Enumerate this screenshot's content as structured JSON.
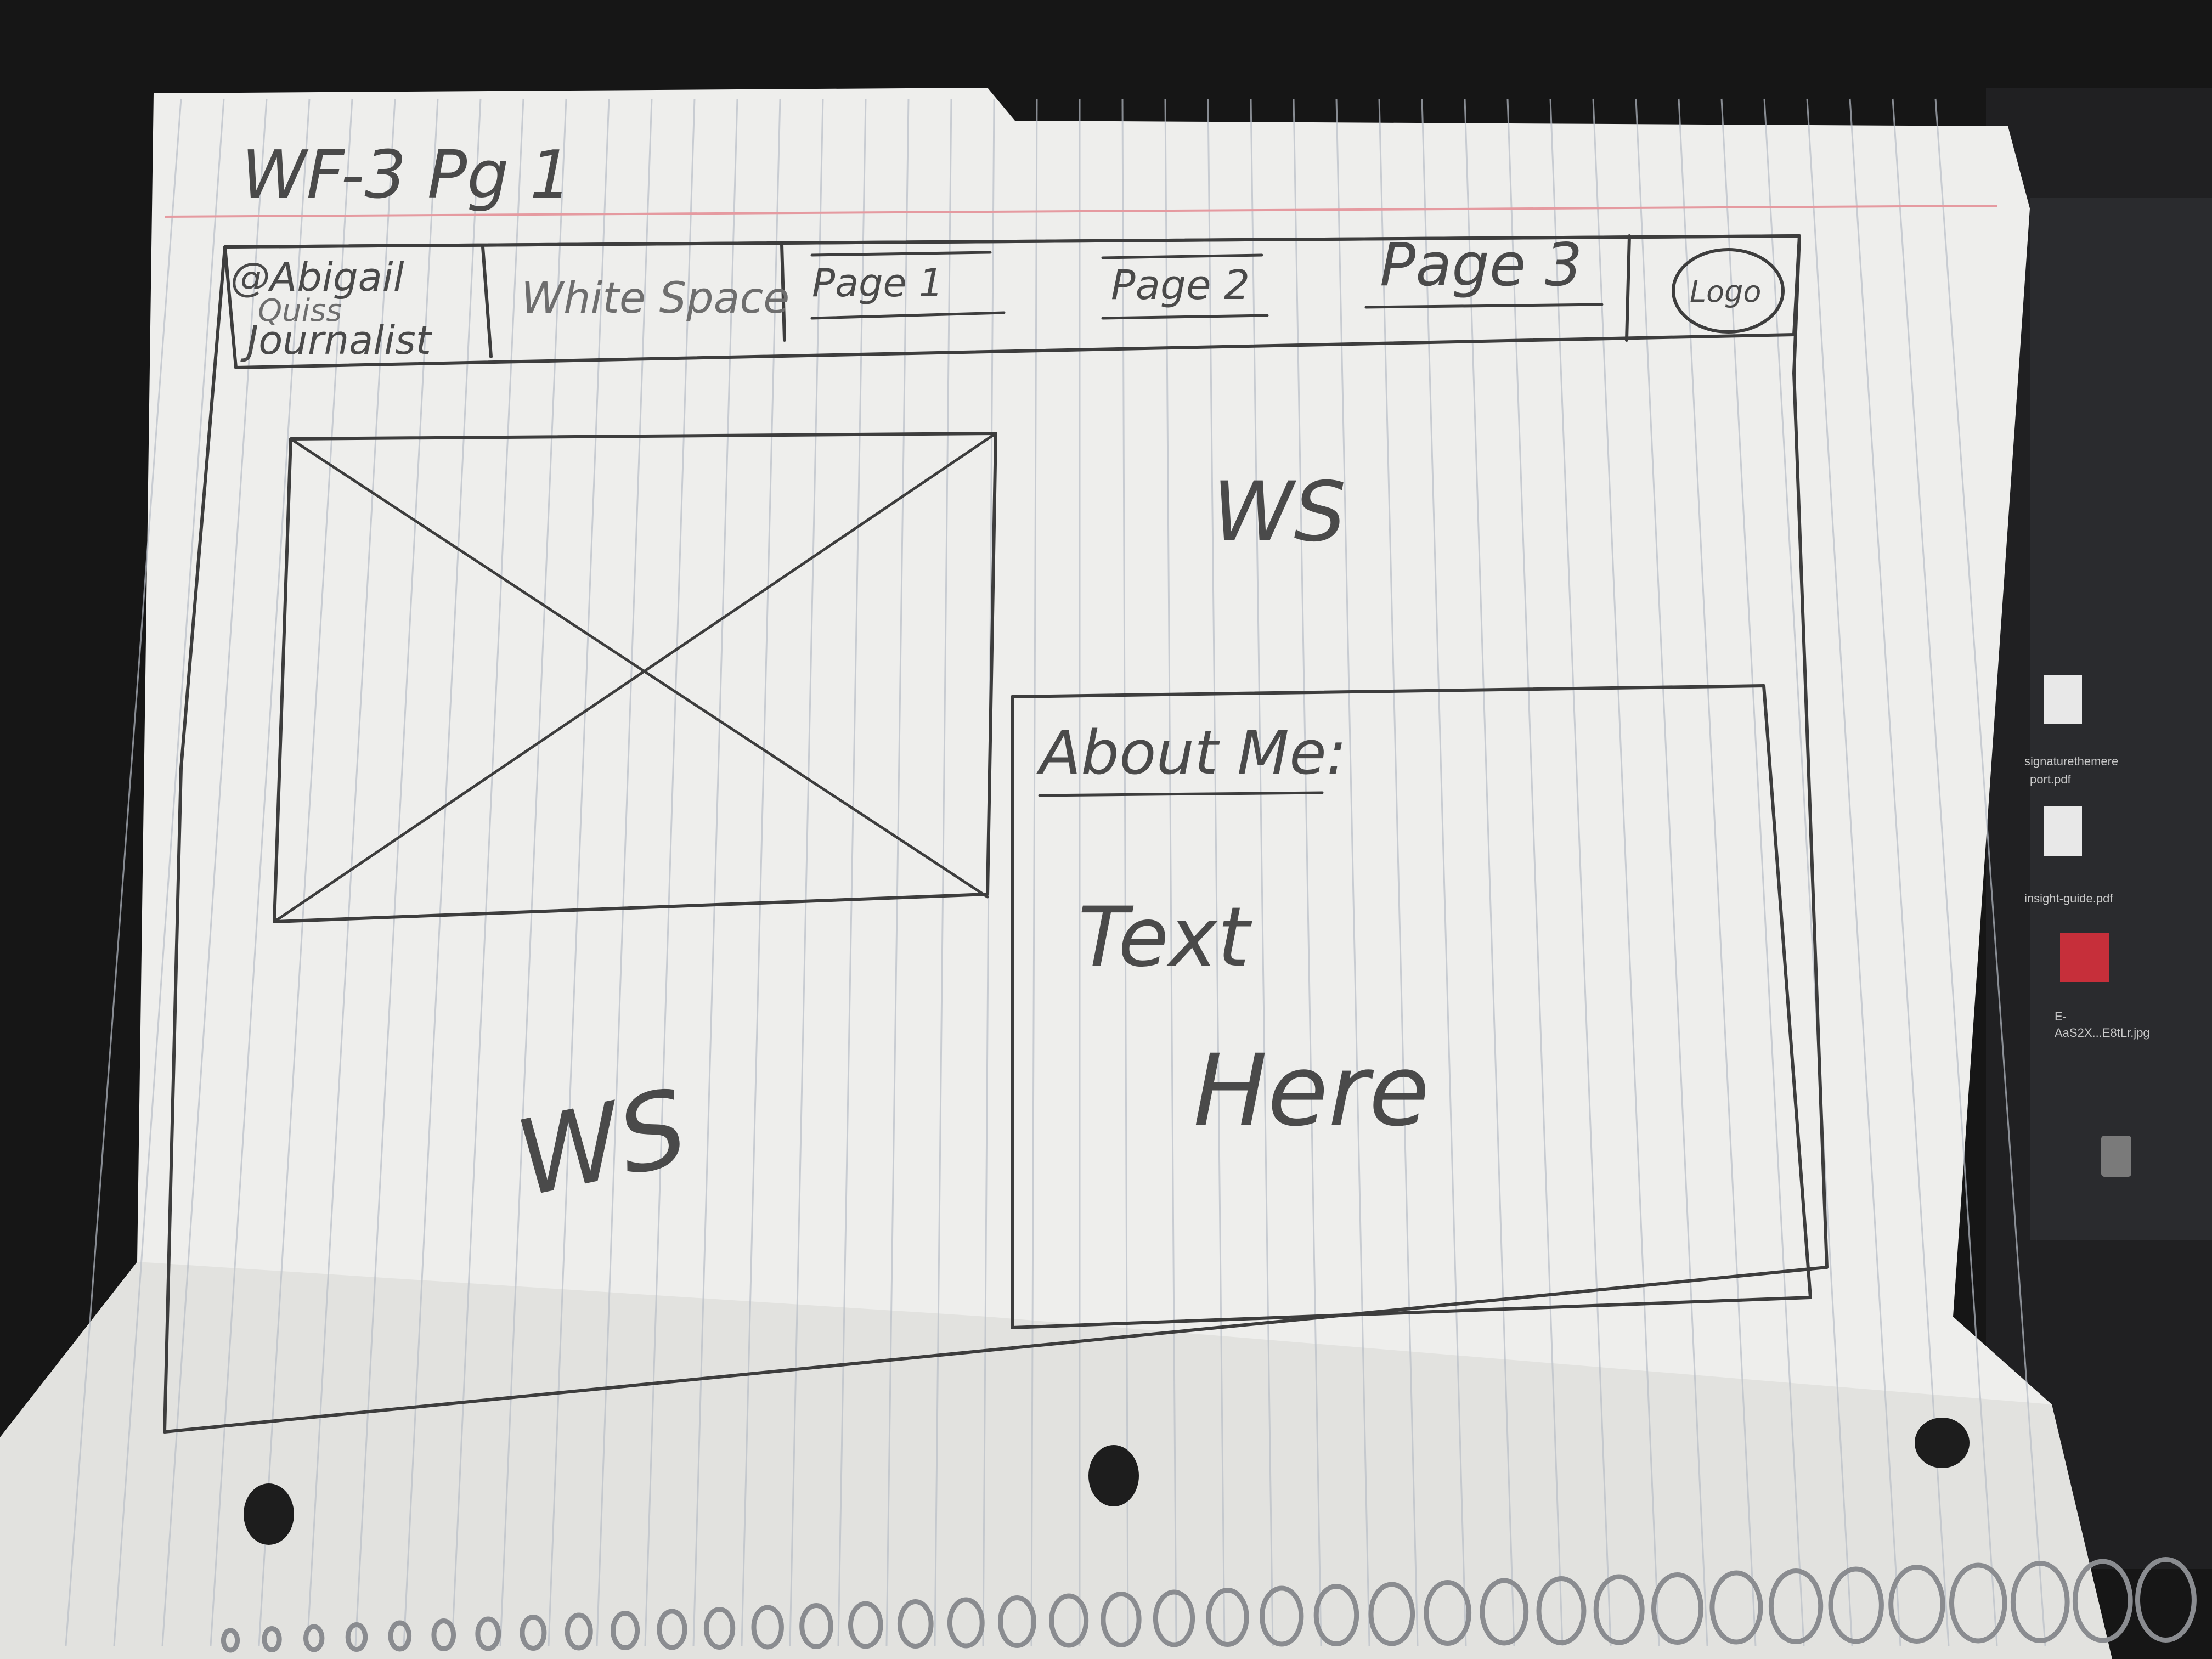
{
  "sheet": {
    "title": "WF-3 Pg 1"
  },
  "nav": {
    "brand_line1": "@Abigail",
    "brand_line2": "Quiss",
    "brand_line3": "Journalist",
    "whitespace_label": "White Space",
    "page1_label": "Page 1",
    "page2_label": "Page 2",
    "page3_label": "Page 3",
    "logo_label": "Logo"
  },
  "content": {
    "ws_top": "WS",
    "ws_bottom": "WS",
    "about_heading": "About Me:",
    "text_line1": "Text",
    "text_line2": "Here"
  },
  "background_sidebar": {
    "files": [
      "signaturethemere",
      "port.pdf",
      "insight-guide.pdf",
      "E-",
      "AaS2X...E8tLr.jpg"
    ]
  }
}
